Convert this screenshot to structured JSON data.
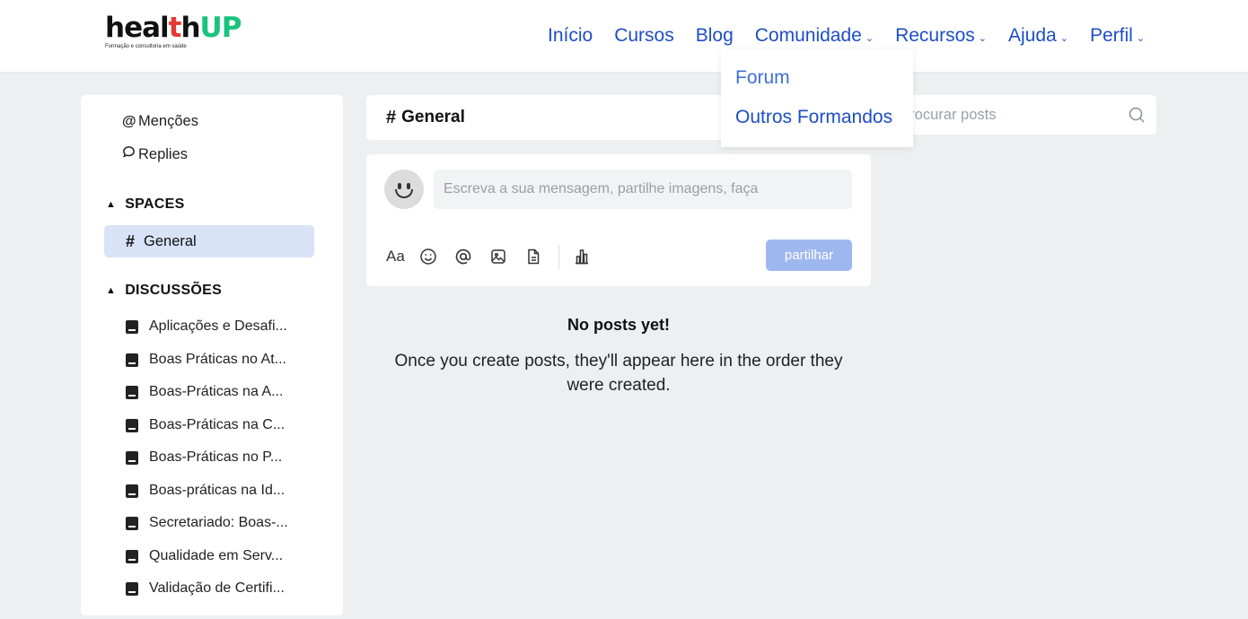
{
  "logo": {
    "part1": "heal",
    "plus": "t",
    "part2": "h",
    "part3": "UP",
    "tagline": "Formação e consultoria em saúde"
  },
  "nav": {
    "items": [
      {
        "label": "Início",
        "has_dropdown": false
      },
      {
        "label": "Cursos",
        "has_dropdown": false
      },
      {
        "label": "Blog",
        "has_dropdown": false
      },
      {
        "label": "Comunidade",
        "has_dropdown": true
      },
      {
        "label": "Recursos",
        "has_dropdown": true
      },
      {
        "label": "Ajuda",
        "has_dropdown": true
      },
      {
        "label": "Perfil",
        "has_dropdown": true
      }
    ],
    "chevron": "⌄"
  },
  "dropdown": {
    "items": [
      "Forum",
      "Outros Formandos"
    ]
  },
  "sidebar": {
    "mentions": {
      "icon": "@",
      "label": "Menções"
    },
    "replies": {
      "label": "Replies"
    },
    "spaces_header": "SPACES",
    "general": {
      "icon": "#",
      "label": "General"
    },
    "discussions_header": "DISCUSSÕES",
    "discussions": [
      "Aplicações e Desafi...",
      "Boas Práticas no At...",
      "Boas-Práticas na A...",
      "Boas-Práticas na C...",
      "Boas-Práticas no P...",
      "Boas-práticas na Id...",
      "Secretariado: Boas-...",
      "Qualidade em Serv...",
      "Validação de Certifi..."
    ]
  },
  "channel": {
    "icon": "#",
    "title": "General"
  },
  "composer": {
    "placeholder": "Escreva a sua mensagem, partilhe imagens, faça",
    "format_label": "Aa",
    "share_label": "partilhar"
  },
  "empty_state": {
    "title": "No posts yet!",
    "text": "Once you create posts, they'll appear here in the order they were created."
  },
  "search": {
    "placeholder": "procurar posts"
  },
  "colors": {
    "nav_link": "#1d4fc4",
    "share_button": "#9eb8ef",
    "active_space": "#d9e3f8",
    "logo_up": "#19c37d",
    "logo_plus": "#e53935"
  }
}
